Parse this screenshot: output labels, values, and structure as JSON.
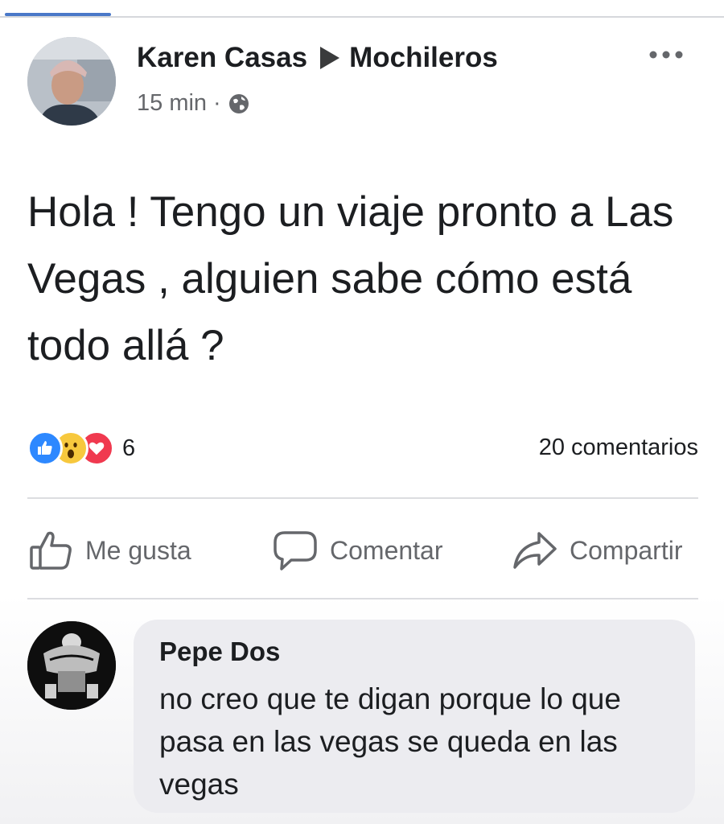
{
  "post": {
    "author": "Karen Casas",
    "group": "Mochileros",
    "time": "15 min",
    "separator": "·",
    "text": "Hola ! Tengo un viaje pronto a Las Vegas , alguien sabe cómo está todo allá ?",
    "reactions": {
      "types": [
        "like",
        "wow",
        "love"
      ],
      "count": "6"
    },
    "comments_count": "20 comentarios"
  },
  "actions": {
    "like": "Me gusta",
    "comment": "Comentar",
    "share": "Compartir"
  },
  "comment": {
    "author": "Pepe Dos",
    "text": "no creo que te digan porque lo que pasa en las vegas se queda en las vegas"
  },
  "colors": {
    "like_blue": "#2d88ff",
    "love_red": "#f0394f",
    "wow_yellow": "#f7c83d",
    "secondary_text": "#65676b",
    "comment_bubble": "#ececf0"
  },
  "icons": {
    "privacy": "globe-icon",
    "options": "more-icon",
    "like_action": "thumbs-up-icon",
    "comment_action": "speech-bubble-icon",
    "share_action": "share-arrow-icon"
  }
}
